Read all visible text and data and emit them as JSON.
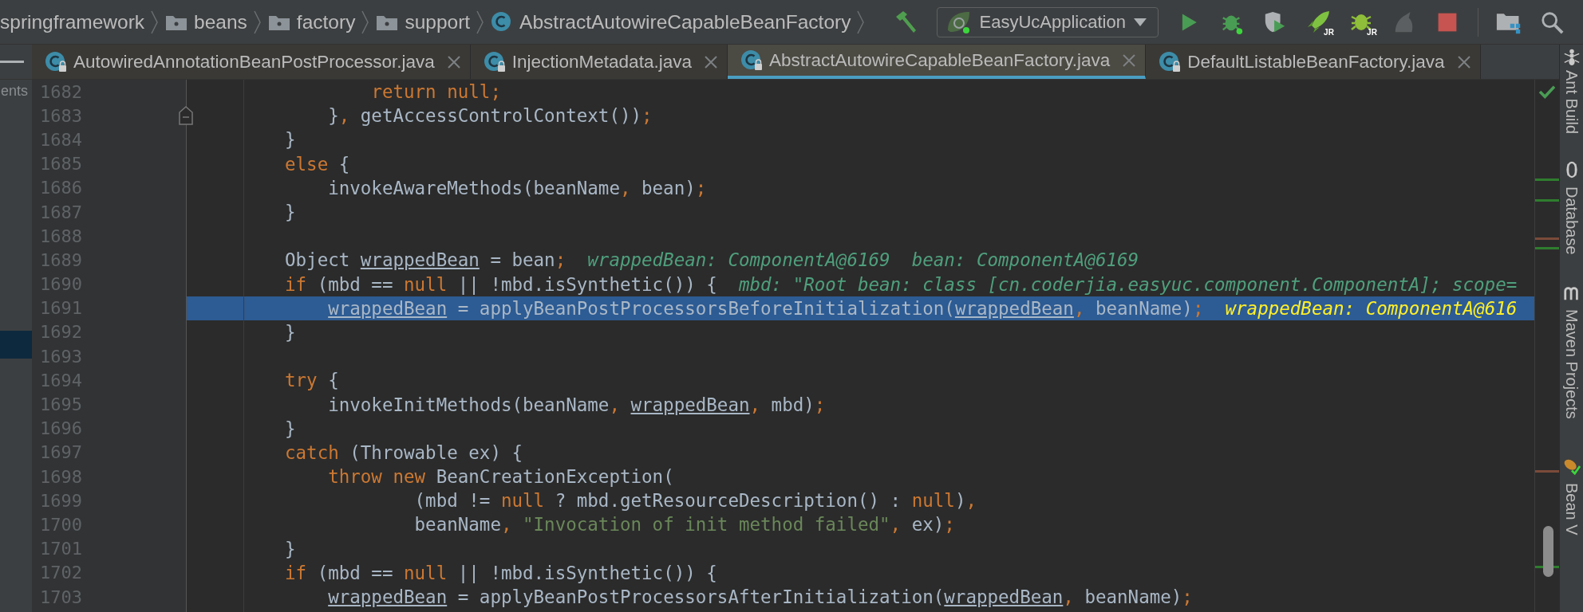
{
  "breadcrumbs": [
    {
      "label": "springframework",
      "kind": "package"
    },
    {
      "label": "beans",
      "kind": "folder"
    },
    {
      "label": "factory",
      "kind": "folder"
    },
    {
      "label": "support",
      "kind": "folder"
    },
    {
      "label": "AbstractAutowireCapableBeanFactory",
      "kind": "class"
    }
  ],
  "run_config": {
    "label": "EasyUcApplication"
  },
  "toolbar": [
    {
      "kind": "build",
      "disabled": false
    },
    {
      "kind": "config"
    },
    {
      "kind": "run",
      "disabled": false
    },
    {
      "kind": "debug",
      "disabled": false
    },
    {
      "kind": "coverage",
      "disabled": false
    },
    {
      "kind": "rocket",
      "disabled": false,
      "badge": "JR"
    },
    {
      "kind": "bug",
      "disabled": false,
      "badge": "JR"
    },
    {
      "kind": "silhouette",
      "disabled": true
    },
    {
      "kind": "stop",
      "disabled": false
    },
    {
      "kind": "separator"
    },
    {
      "kind": "structure",
      "disabled": false
    },
    {
      "kind": "search",
      "disabled": false
    }
  ],
  "left_panel": {
    "label": "ents"
  },
  "tabs": [
    {
      "label": "AutowiredAnnotationBeanPostProcessor.java",
      "selected": false
    },
    {
      "label": "InjectionMetadata.java",
      "selected": false
    },
    {
      "label": "AbstractAutowireCapableBeanFactory.java",
      "selected": true
    },
    {
      "label": "DefaultListableBeanFactory.java",
      "selected": false
    }
  ],
  "editor": {
    "lines": [
      {
        "number": "1682",
        "selected": false,
        "code": [
          {
            "kind": "keyword",
            "text": "        return "
          },
          {
            "kind": "keyword",
            "text": "null"
          },
          {
            "kind": "punct",
            "text": ";"
          }
        ]
      },
      {
        "number": "1683",
        "selected": false,
        "code": [
          {
            "kind": "plain",
            "text": "    }"
          },
          {
            "kind": "punct",
            "text": ","
          },
          {
            "kind": "plain",
            "text": " getAccessControlContext())"
          },
          {
            "kind": "punct",
            "text": ";"
          }
        ]
      },
      {
        "number": "1684",
        "selected": false,
        "code": [
          {
            "kind": "plain",
            "text": "}"
          }
        ]
      },
      {
        "number": "1685",
        "selected": false,
        "code": [
          {
            "kind": "keyword",
            "text": "else "
          },
          {
            "kind": "plain",
            "text": "{"
          }
        ]
      },
      {
        "number": "1686",
        "selected": false,
        "code": [
          {
            "kind": "plain",
            "text": "    invokeAwareMethods(beanName"
          },
          {
            "kind": "punct",
            "text": ","
          },
          {
            "kind": "plain",
            "text": " bean)"
          },
          {
            "kind": "punct",
            "text": ";"
          }
        ]
      },
      {
        "number": "1687",
        "selected": false,
        "code": [
          {
            "kind": "plain",
            "text": "}"
          }
        ]
      },
      {
        "number": "1688",
        "selected": false
      },
      {
        "number": "1689",
        "selected": false,
        "code": [
          {
            "kind": "plain",
            "text": "Object "
          },
          {
            "kind": "var",
            "text": "wrappedBean"
          },
          {
            "kind": "plain",
            "text": " = bean"
          },
          {
            "kind": "punct",
            "text": ";"
          }
        ],
        "inline_value": "wrappedBean: ComponentA@6169  bean: ComponentA@6169"
      },
      {
        "number": "1690",
        "selected": false,
        "code": [
          {
            "kind": "keyword",
            "text": "if "
          },
          {
            "kind": "plain",
            "text": "(mbd == "
          },
          {
            "kind": "keyword",
            "text": "null "
          },
          {
            "kind": "plain",
            "text": "|| !mbd.isSynthetic()) {"
          }
        ],
        "inline_value": "mbd: \"Root bean: class [cn.coderjia.easyuc.component.ComponentA]; scope="
      },
      {
        "number": "1691",
        "selected": true,
        "code": [
          {
            "kind": "var",
            "text": "    wrappedBean"
          },
          {
            "kind": "plain",
            "text": " = applyBeanPostProcessorsBeforeInitialization("
          },
          {
            "kind": "var",
            "text": "wrappedBean"
          },
          {
            "kind": "punct",
            "text": ","
          },
          {
            "kind": "plain",
            "text": " beanName)"
          },
          {
            "kind": "punct",
            "text": ";"
          }
        ],
        "inline_value": "wrappedBean: ComponentA@616"
      },
      {
        "number": "1692",
        "selected": false,
        "code": [
          {
            "kind": "plain",
            "text": "}"
          }
        ]
      },
      {
        "number": "1693",
        "selected": false
      },
      {
        "number": "1694",
        "selected": false,
        "code": [
          {
            "kind": "keyword",
            "text": "try "
          },
          {
            "kind": "plain",
            "text": "{"
          }
        ]
      },
      {
        "number": "1695",
        "selected": false,
        "code": [
          {
            "kind": "plain",
            "text": "    invokeInitMethods(beanName"
          },
          {
            "kind": "punct",
            "text": ","
          },
          {
            "kind": "var",
            "text": " wrappedBean"
          },
          {
            "kind": "punct",
            "text": ","
          },
          {
            "kind": "plain",
            "text": " mbd)"
          },
          {
            "kind": "punct",
            "text": ";"
          }
        ]
      },
      {
        "number": "1696",
        "selected": false,
        "code": [
          {
            "kind": "plain",
            "text": "}"
          }
        ]
      },
      {
        "number": "1697",
        "selected": false,
        "code": [
          {
            "kind": "keyword",
            "text": "catch "
          },
          {
            "kind": "plain",
            "text": "(Throwable ex) {"
          }
        ]
      },
      {
        "number": "1698",
        "selected": false,
        "code": [
          {
            "kind": "keyword",
            "text": "    throw new "
          },
          {
            "kind": "plain",
            "text": "BeanCreationException("
          }
        ]
      },
      {
        "number": "1699",
        "selected": false,
        "code": [
          {
            "kind": "plain",
            "text": "            (mbd != "
          },
          {
            "kind": "keyword",
            "text": "null "
          },
          {
            "kind": "plain",
            "text": "? mbd.getResourceDescription() : "
          },
          {
            "kind": "keyword",
            "text": "null"
          },
          {
            "kind": "plain",
            "text": ")"
          },
          {
            "kind": "punct",
            "text": ","
          }
        ]
      },
      {
        "number": "1700",
        "selected": false,
        "code": [
          {
            "kind": "plain",
            "text": "            beanName"
          },
          {
            "kind": "punct",
            "text": ","
          },
          {
            "kind": "string",
            "text": " \"Invocation of init method failed\""
          },
          {
            "kind": "punct",
            "text": ","
          },
          {
            "kind": "plain",
            "text": " ex)"
          },
          {
            "kind": "punct",
            "text": ";"
          }
        ]
      },
      {
        "number": "1701",
        "selected": false,
        "code": [
          {
            "kind": "plain",
            "text": "}"
          }
        ]
      },
      {
        "number": "1702",
        "selected": false,
        "code": [
          {
            "kind": "keyword",
            "text": "if "
          },
          {
            "kind": "plain",
            "text": "(mbd == "
          },
          {
            "kind": "keyword",
            "text": "null "
          },
          {
            "kind": "plain",
            "text": "|| !mbd.isSynthetic()) {"
          }
        ]
      },
      {
        "number": "1703",
        "selected": false,
        "code": [
          {
            "kind": "var",
            "text": "    wrappedBean"
          },
          {
            "kind": "plain",
            "text": " = applyBeanPostProcessorsAfterInitialization("
          },
          {
            "kind": "var",
            "text": "wrappedBean"
          },
          {
            "kind": "punct",
            "text": ","
          },
          {
            "kind": "plain",
            "text": " beanName)"
          },
          {
            "kind": "punct",
            "text": ";"
          }
        ]
      }
    ]
  },
  "tool_windows": [
    {
      "label": "Ant Build",
      "kind": "ant"
    },
    {
      "label": "Database",
      "kind": "database"
    },
    {
      "label": "Maven Projects",
      "kind": "maven"
    },
    {
      "label": "Bean V",
      "kind": "bean"
    }
  ]
}
